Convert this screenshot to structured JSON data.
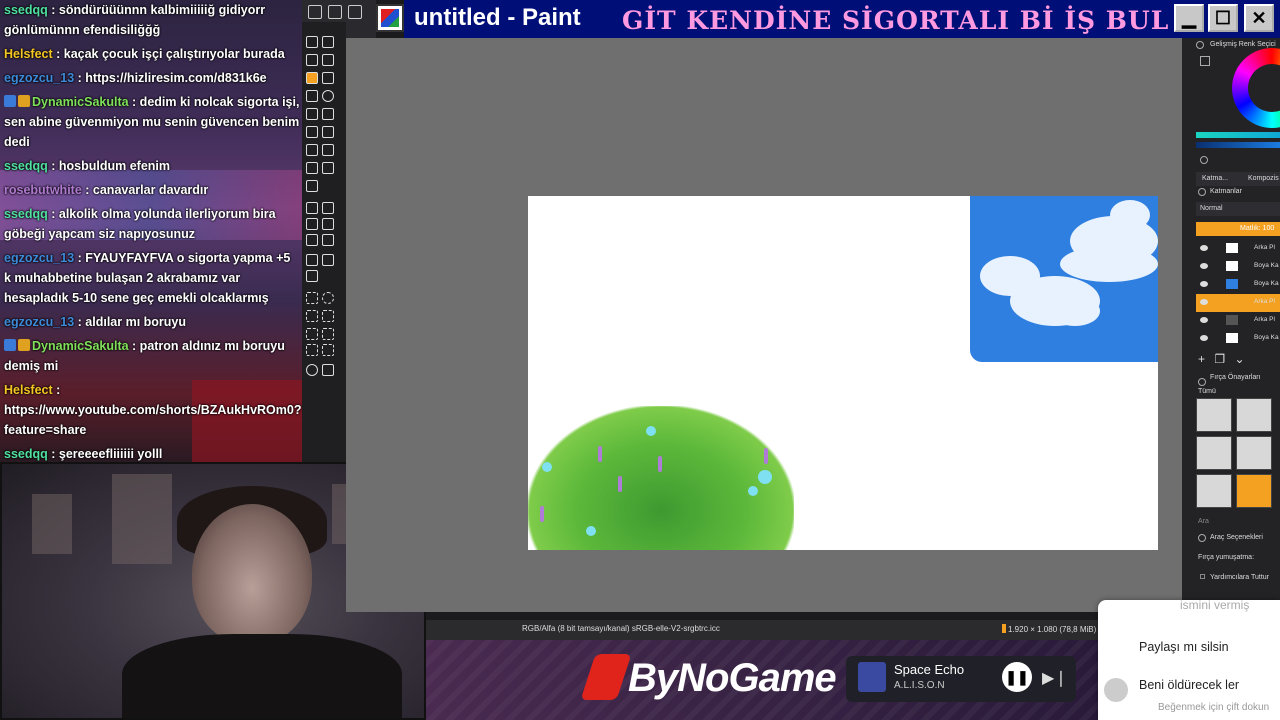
{
  "chat": {
    "messages": [
      {
        "user": "ssedqq",
        "color": "#4fe0a0",
        "text": "söndürüüünnn kalbimiiiiiğ gidiyorr gönlümünnn efendisiliğğğ",
        "badges": false
      },
      {
        "user": "Helsfect",
        "color": "#f5c623",
        "text": "kaçak çocuk işçi çalıştırıyolar burada",
        "badges": false
      },
      {
        "user": "egzozcu_13",
        "color": "#3d8ad8",
        "text": "https://hizliresim.com/d831k6e",
        "badges": false
      },
      {
        "user": "DynamicSakulta",
        "color": "#7fe05a",
        "text": "dedim ki nolcak sigorta işi, sen abine güvenmiyon mu senin güvencen benim dedi",
        "badges": true
      },
      {
        "user": "ssedqq",
        "color": "#4fe0a0",
        "text": "hosbuldum efenim",
        "badges": false
      },
      {
        "user": "rosebutwhite",
        "color": "#b07ad0",
        "text": "canavarlar davardır",
        "badges": false
      },
      {
        "user": "ssedqq",
        "color": "#4fe0a0",
        "text": "alkolik olma yolunda ilerliyorum bira göbeği yapcam siz napıyosunuz",
        "badges": false
      },
      {
        "user": "egzozcu_13",
        "color": "#3d8ad8",
        "text": "FYAUYFAYFVA o sigorta yapma +5 k muhabbetine bulaşan 2 akrabamız var hesapladık 5-10 sene geç emekli olcaklarmış",
        "badges": false
      },
      {
        "user": "egzozcu_13",
        "color": "#3d8ad8",
        "text": "aldılar mı boruyu",
        "badges": false
      },
      {
        "user": "DynamicSakulta",
        "color": "#7fe05a",
        "text": "patron aldınız mı boruyu demiş mi",
        "badges": true
      },
      {
        "user": "Helsfect",
        "color": "#f5c623",
        "text": "https://www.youtube.com/shorts/BZAukHvROm0?feature=share",
        "badges": false
      },
      {
        "user": "ssedqq",
        "color": "#4fe0a0",
        "text": "şereeeefliiiiii yolll",
        "badges": false
      }
    ]
  },
  "window": {
    "title": "untitled - Paint",
    "marquee": "GİT KENDİNE SİGORTALI Bİ İŞ BUL",
    "minimize": "▁",
    "maximize": "☐",
    "close": "✕"
  },
  "status": {
    "format": "RGB/Alfa (8 bit tamsayı/kanal) sRGB-elle-V2-srgbtrc.icc",
    "size": "1.920 × 1.080 (78,8 MiB)"
  },
  "dock": {
    "color_panel": "Gelişmiş Renk Seçici",
    "tab_layers": "Katma...",
    "tab_compose": "Kompozis",
    "layers_panel": "Katmanlar",
    "blend_mode": "Normal",
    "opacity": "Matlık: 100",
    "layers": [
      {
        "name": "Arka Pl",
        "active": false,
        "thumb": "#ffffff"
      },
      {
        "name": "Boya Ka",
        "active": false,
        "thumb": "#ffffff"
      },
      {
        "name": "Boya Ka",
        "active": false,
        "thumb": "#2f7fe0"
      },
      {
        "name": "Arka Pl",
        "active": true,
        "thumb": "#f4a020"
      },
      {
        "name": "Arka Pl",
        "active": false,
        "thumb": "#555555"
      },
      {
        "name": "Boya Ka",
        "active": false,
        "thumb": "#ffffff"
      }
    ],
    "brush_panel": "Fırça Önayarları",
    "brush_filter": "Tümü",
    "search": "Ara",
    "tool_options": "Araç Seçenekleri",
    "brush_smoothing": "Fırça yumuşatma:",
    "assistants": "Yardımcılara Tuttur"
  },
  "footer": {
    "brand": "ByNoGame",
    "song_title": "Space Echo",
    "song_artist": "A.L.I.S.O.N",
    "pause": "❚❚",
    "next": "▶❘"
  },
  "popup": {
    "hidden_text": "ismini vermiş",
    "item1": "Paylaşı mı silsin",
    "item2": "Beni öldürecek ler",
    "hint": "Beğenmek için çift dokun"
  }
}
